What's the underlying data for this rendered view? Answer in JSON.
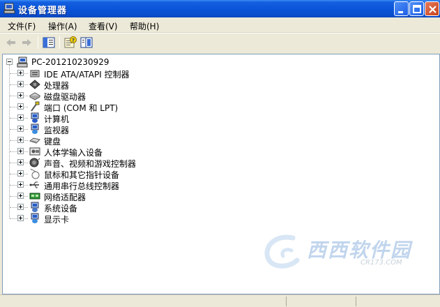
{
  "window": {
    "title": "设备管理器"
  },
  "menu": [
    {
      "label": "文件(F)"
    },
    {
      "label": "操作(A)"
    },
    {
      "label": "查看(V)"
    },
    {
      "label": "帮助(H)"
    }
  ],
  "tree": {
    "root": {
      "label": "PC-201210230929",
      "icon": "computer-icon"
    },
    "nodes": [
      {
        "label": "IDE ATA/ATAPI 控制器",
        "icon": "ide-controller-icon"
      },
      {
        "label": "处理器",
        "icon": "processor-icon"
      },
      {
        "label": "磁盘驱动器",
        "icon": "disk-drive-icon"
      },
      {
        "label": "端口 (COM 和 LPT)",
        "icon": "port-icon"
      },
      {
        "label": "计算机",
        "icon": "computer-icon"
      },
      {
        "label": "监视器",
        "icon": "monitor-icon"
      },
      {
        "label": "键盘",
        "icon": "keyboard-icon"
      },
      {
        "label": "人体学输入设备",
        "icon": "hid-icon"
      },
      {
        "label": "声音、视频和游戏控制器",
        "icon": "sound-icon"
      },
      {
        "label": "鼠标和其它指针设备",
        "icon": "mouse-icon"
      },
      {
        "label": "通用串行总线控制器",
        "icon": "usb-icon"
      },
      {
        "label": "网络适配器",
        "icon": "network-adapter-icon"
      },
      {
        "label": "系统设备",
        "icon": "system-device-icon"
      },
      {
        "label": "显示卡",
        "icon": "display-adapter-icon"
      }
    ]
  },
  "watermark": {
    "text": "西西软件园",
    "sub": "CR173.COM"
  }
}
